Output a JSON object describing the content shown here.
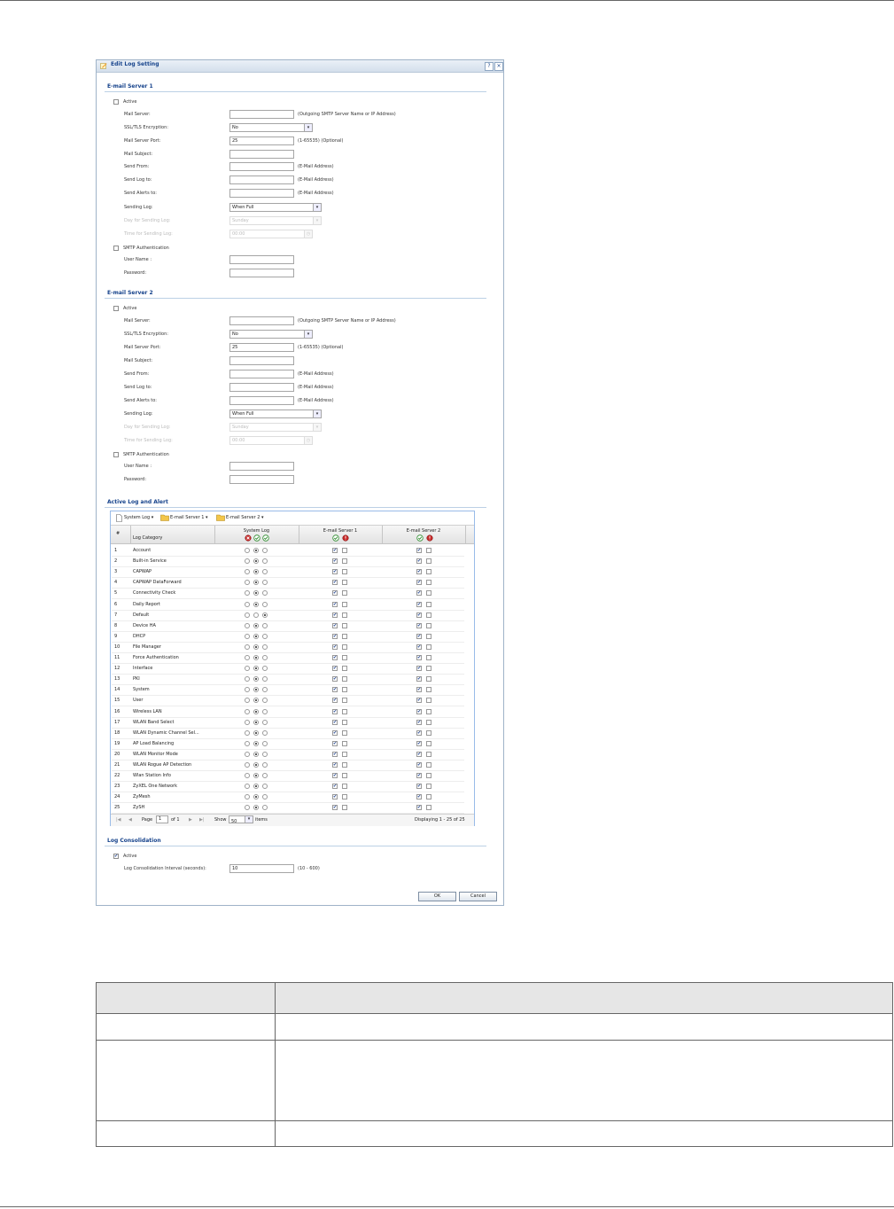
{
  "dialog": {
    "title": "Edit Log Setting",
    "help_label": "?",
    "close_label": "×",
    "ok_label": "OK",
    "cancel_label": "Cancel"
  },
  "server1": {
    "section_title": "E-mail Server 1",
    "active_label": "Active",
    "active_checked": false,
    "mail_server_label": "Mail Server:",
    "mail_server_value": "",
    "mail_server_hint": "(Outgoing SMTP Server Name or IP Address)",
    "encryption_label": "SSL/TLS Encryption:",
    "encryption_value": "No",
    "port_label": "Mail Server Port:",
    "port_value": "25",
    "port_hint": "(1-65535) (Optional)",
    "subject_label": "Mail Subject:",
    "send_from_label": "Send From:",
    "send_from_hint": "(E-Mail Address)",
    "send_log_label": "Send Log to:",
    "send_log_hint": "(E-Mail Address)",
    "send_alerts_label": "Send Alerts to:",
    "send_alerts_hint": "(E-Mail Address)",
    "sending_log_label": "Sending Log:",
    "sending_log_value": "When Full",
    "day_label": "Day for Sending Log:",
    "day_value": "Sunday",
    "time_label": "Time for Sending Log:",
    "time_value": "00:00",
    "smtp_auth_label": "SMTP Authentication",
    "user_label": "User Name :",
    "password_label": "Password:"
  },
  "server2": {
    "section_title": "E-mail Server 2",
    "active_label": "Active",
    "active_checked": false,
    "mail_server_label": "Mail Server:",
    "mail_server_value": "",
    "mail_server_hint": "(Outgoing SMTP Server Name or IP Address)",
    "encryption_label": "SSL/TLS Encryption:",
    "encryption_value": "No",
    "port_label": "Mail Server Port:",
    "port_value": "25",
    "port_hint": "(1-65535) (Optional)",
    "subject_label": "Mail Subject:",
    "send_from_label": "Send From:",
    "send_from_hint": "(E-Mail Address)",
    "send_log_label": "Send Log to:",
    "send_log_hint": "(E-Mail Address)",
    "send_alerts_label": "Send Alerts to:",
    "send_alerts_hint": "(E-Mail Address)",
    "sending_log_label": "Sending Log:",
    "sending_log_value": "When Full",
    "day_label": "Day for Sending Log:",
    "day_value": "Sunday",
    "time_label": "Time for Sending Log:",
    "time_value": "00:00",
    "smtp_auth_label": "SMTP Authentication",
    "user_label": "User Name :",
    "password_label": "Password:"
  },
  "alerts": {
    "section_title": "Active Log and Alert",
    "toolbar": {
      "system_log": "System Log",
      "server1": "E-mail Server 1",
      "server2": "E-mail Server 2"
    },
    "columns": {
      "num": "#",
      "category": "Log Category",
      "system_log": "System Log",
      "server1": "E-mail Server 1",
      "server2": "E-mail Server 2"
    },
    "rows": [
      {
        "n": "1",
        "name": "Account",
        "sys": 1,
        "s1": true,
        "s2": true
      },
      {
        "n": "2",
        "name": "Built-in Service",
        "sys": 1,
        "s1": true,
        "s2": true
      },
      {
        "n": "3",
        "name": "CAPWAP",
        "sys": 1,
        "s1": true,
        "s2": true
      },
      {
        "n": "4",
        "name": "CAPWAP DataForward",
        "sys": 1,
        "s1": true,
        "s2": true
      },
      {
        "n": "5",
        "name": "Connectivity Check",
        "sys": 1,
        "s1": true,
        "s2": true
      },
      {
        "n": "6",
        "name": "Daily Report",
        "sys": 1,
        "s1": true,
        "s2": true
      },
      {
        "n": "7",
        "name": "Default",
        "sys": 2,
        "s1": true,
        "s2": true
      },
      {
        "n": "8",
        "name": "Device HA",
        "sys": 1,
        "s1": true,
        "s2": true
      },
      {
        "n": "9",
        "name": "DHCP",
        "sys": 1,
        "s1": true,
        "s2": true
      },
      {
        "n": "10",
        "name": "File Manager",
        "sys": 1,
        "s1": true,
        "s2": true
      },
      {
        "n": "11",
        "name": "Force Authentication",
        "sys": 1,
        "s1": true,
        "s2": true
      },
      {
        "n": "12",
        "name": "Interface",
        "sys": 1,
        "s1": true,
        "s2": true
      },
      {
        "n": "13",
        "name": "PKI",
        "sys": 1,
        "s1": true,
        "s2": true
      },
      {
        "n": "14",
        "name": "System",
        "sys": 1,
        "s1": true,
        "s2": true
      },
      {
        "n": "15",
        "name": "User",
        "sys": 1,
        "s1": true,
        "s2": true
      },
      {
        "n": "16",
        "name": "Wireless LAN",
        "sys": 1,
        "s1": true,
        "s2": true
      },
      {
        "n": "17",
        "name": "WLAN Band Select",
        "sys": 1,
        "s1": true,
        "s2": true
      },
      {
        "n": "18",
        "name": "WLAN Dynamic Channel Sel...",
        "sys": 1,
        "s1": true,
        "s2": true
      },
      {
        "n": "19",
        "name": "AP Load Balancing",
        "sys": 1,
        "s1": true,
        "s2": true
      },
      {
        "n": "20",
        "name": "WLAN Monitor Mode",
        "sys": 1,
        "s1": true,
        "s2": true
      },
      {
        "n": "21",
        "name": "WLAN Rogue AP Detection",
        "sys": 1,
        "s1": true,
        "s2": true
      },
      {
        "n": "22",
        "name": "Wlan Station Info",
        "sys": 1,
        "s1": true,
        "s2": true
      },
      {
        "n": "23",
        "name": "ZyXEL One Network",
        "sys": 1,
        "s1": true,
        "s2": true
      },
      {
        "n": "24",
        "name": "ZyMesh",
        "sys": 1,
        "s1": true,
        "s2": true
      },
      {
        "n": "25",
        "name": "ZySH",
        "sys": 1,
        "s1": true,
        "s2": true
      }
    ],
    "paging": {
      "page_label": "Page",
      "page_value": "1",
      "of_label": "of 1",
      "show_label": "Show",
      "show_value": "50",
      "items_label": "items",
      "displaying": "Displaying 1 - 25 of 25"
    }
  },
  "consolidation": {
    "section_title": "Log Consolidation",
    "active_label": "Active",
    "active_checked": true,
    "interval_label": "Log Consolidation Interval (seconds):",
    "interval_value": "10",
    "interval_hint": "(10 - 600)"
  },
  "colors": {
    "accent": "#15428b",
    "grid_border": "#99bbe8",
    "checkmark": "#1a3d8a",
    "ok_green": "#2e8b2e",
    "disable_red": "#c62828"
  }
}
